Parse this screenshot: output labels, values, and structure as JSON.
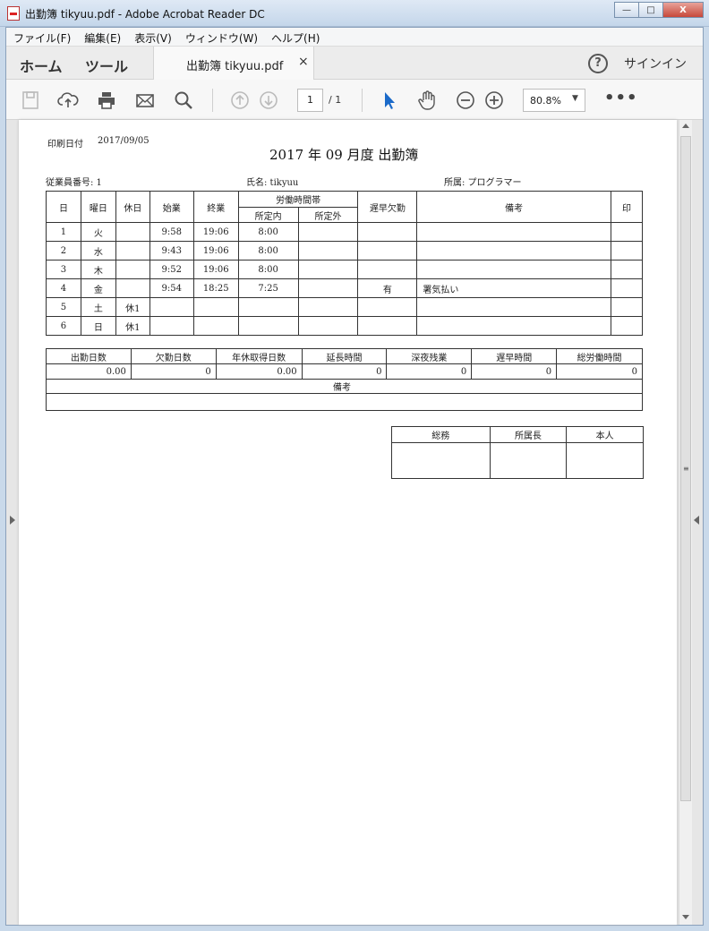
{
  "window": {
    "title": "出勤簿 tikyuu.pdf - Adobe Acrobat Reader DC",
    "controls": {
      "minimize": "—",
      "maximize": "□",
      "close": "X"
    }
  },
  "menu": [
    {
      "label": "ファイル(F)"
    },
    {
      "label": "編集(E)"
    },
    {
      "label": "表示(V)"
    },
    {
      "label": "ウィンドウ(W)"
    },
    {
      "label": "ヘルプ(H)"
    }
  ],
  "tabs": {
    "home": "ホーム",
    "tools": "ツール",
    "document": "出勤簿 tikyuu.pdf",
    "close": "×",
    "help": "?",
    "signin": "サインイン"
  },
  "toolbar": {
    "page_current": "1",
    "page_total": "/ 1",
    "zoom": "80.8%",
    "zoom_caret": "▼",
    "more": "•••"
  },
  "document": {
    "print_date_label": "印刷日付",
    "print_date": "2017/09/05",
    "title": "2017 年 09 月度 出勤簿",
    "employee_number": "従業員番号: 1",
    "name": "氏名: tikyuu",
    "department": "所属: プログラマー",
    "attendance": {
      "headers": {
        "day": "日",
        "weekday": "曜日",
        "holiday": "休日",
        "start": "始業",
        "end": "終業",
        "work_hours": "労働時間帯",
        "within": "所定内",
        "outside": "所定外",
        "late_absent": "遅早欠勤",
        "remarks": "備考",
        "seal": "印"
      },
      "rows": [
        {
          "day": "1",
          "weekday": "火",
          "holiday": "",
          "start": "9:58",
          "end": "19:06",
          "within": "8:00",
          "outside": "",
          "late": "",
          "remarks": "",
          "seal": ""
        },
        {
          "day": "2",
          "weekday": "水",
          "holiday": "",
          "start": "9:43",
          "end": "19:06",
          "within": "8:00",
          "outside": "",
          "late": "",
          "remarks": "",
          "seal": ""
        },
        {
          "day": "3",
          "weekday": "木",
          "holiday": "",
          "start": "9:52",
          "end": "19:06",
          "within": "8:00",
          "outside": "",
          "late": "",
          "remarks": "",
          "seal": ""
        },
        {
          "day": "4",
          "weekday": "金",
          "holiday": "",
          "start": "9:54",
          "end": "18:25",
          "within": "7:25",
          "outside": "",
          "late": "有",
          "remarks": "署気払い",
          "seal": ""
        },
        {
          "day": "5",
          "weekday": "土",
          "holiday": "休1",
          "start": "",
          "end": "",
          "within": "",
          "outside": "",
          "late": "",
          "remarks": "",
          "seal": ""
        },
        {
          "day": "6",
          "weekday": "日",
          "holiday": "休1",
          "start": "",
          "end": "",
          "within": "",
          "outside": "",
          "late": "",
          "remarks": "",
          "seal": ""
        }
      ]
    },
    "summary": {
      "headers": [
        "出勤日数",
        "欠勤日数",
        "年休取得日数",
        "延長時間",
        "深夜残業",
        "遅早時間",
        "総労働時間"
      ],
      "values": [
        "0.00",
        "0",
        "0.00",
        "0",
        "0",
        "0",
        "0"
      ],
      "remarks_label": "備考"
    },
    "approval": {
      "headers": [
        "総務",
        "所属長",
        "本人"
      ]
    }
  }
}
